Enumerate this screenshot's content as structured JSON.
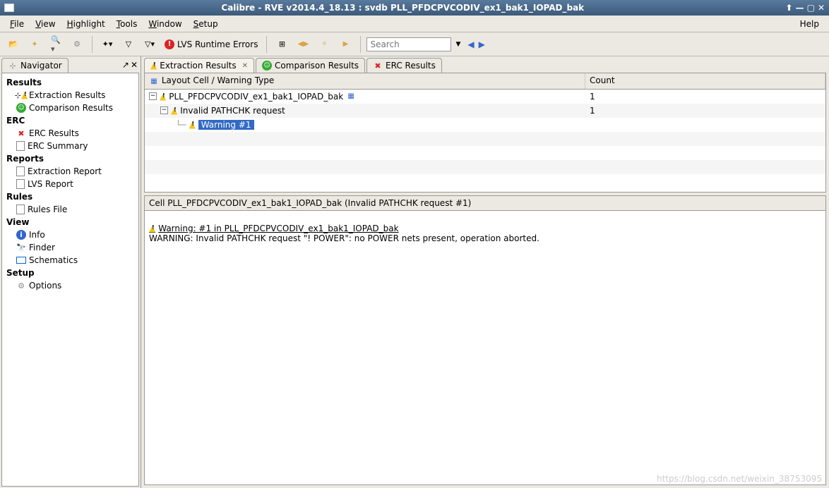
{
  "window": {
    "title": "Calibre - RVE v2014.4_18.13 : svdb PLL_PFDCPVCODIV_ex1_bak1_IOPAD_bak"
  },
  "menu": {
    "file": "File",
    "view": "View",
    "highlight": "Highlight",
    "tools": "Tools",
    "window": "Window",
    "setup": "Setup",
    "help": "Help"
  },
  "toolbar": {
    "lvs_errors": "LVS Runtime Errors",
    "search_placeholder": "Search"
  },
  "navigator": {
    "title": "Navigator",
    "sections": {
      "results": "Results",
      "erc": "ERC",
      "reports": "Reports",
      "rules": "Rules",
      "view": "View",
      "setup": "Setup"
    },
    "items": {
      "extraction_results": "Extraction Results",
      "comparison_results": "Comparison Results",
      "erc_results": "ERC Results",
      "erc_summary": "ERC Summary",
      "extraction_report": "Extraction Report",
      "lvs_report": "LVS Report",
      "rules_file": "Rules File",
      "info": "Info",
      "finder": "Finder",
      "schematics": "Schematics",
      "options": "Options"
    }
  },
  "tabs": {
    "extraction": "Extraction Results",
    "comparison": "Comparison Results",
    "erc": "ERC Results"
  },
  "results_table": {
    "header_cell": "Layout Cell / Warning Type",
    "header_count": "Count",
    "rows": [
      {
        "label": "PLL_PFDCPVCODIV_ex1_bak1_IOPAD_bak",
        "count": "1"
      },
      {
        "label": "Invalid PATHCHK request",
        "count": "1"
      },
      {
        "label": "Warning #1",
        "count": ""
      }
    ]
  },
  "detail": {
    "header": "Cell PLL_PFDCPVCODIV_ex1_bak1_IOPAD_bak (Invalid PATHCHK request #1)",
    "warning_line": "Warning: #1 in PLL_PFDCPVCODIV_ex1_bak1_IOPAD_bak",
    "body": "WARNING: Invalid PATHCHK request \"! POWER\": no POWER nets present, operation aborted."
  },
  "watermark": "https://blog.csdn.net/weixin_38753095"
}
